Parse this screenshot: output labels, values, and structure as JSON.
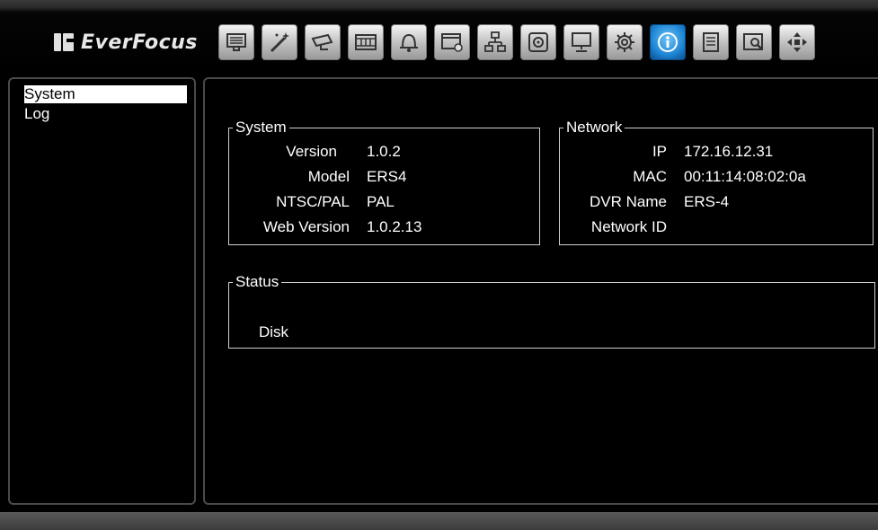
{
  "brand": {
    "logo_text": "EverFocus"
  },
  "toolbar": {
    "buttons": [
      {
        "icon": "monitor-live-icon"
      },
      {
        "icon": "wand-icon"
      },
      {
        "icon": "camera-icon"
      },
      {
        "icon": "film-icon"
      },
      {
        "icon": "bell-alarm-icon"
      },
      {
        "icon": "schedule-icon"
      },
      {
        "icon": "network-icon"
      },
      {
        "icon": "disk-icon"
      },
      {
        "icon": "display-icon"
      },
      {
        "icon": "gear-icon"
      },
      {
        "icon": "info-icon",
        "active": true
      },
      {
        "icon": "log-icon"
      },
      {
        "icon": "search-playback-icon"
      },
      {
        "icon": "move-arrows-icon"
      }
    ]
  },
  "sidebar": {
    "items": [
      {
        "label": "System",
        "selected": true
      },
      {
        "label": "Log",
        "selected": false
      }
    ]
  },
  "system": {
    "title": "System",
    "version_label": "Version",
    "version_value": "1.0.2",
    "model_label": "Model",
    "model_value": "ERS4",
    "ntsc_label": "NTSC/PAL",
    "ntsc_value": "PAL",
    "web_label": "Web Version",
    "web_value": "1.0.2.13"
  },
  "network": {
    "title": "Network",
    "ip_label": "IP",
    "ip_value": "172.16.12.31",
    "mac_label": "MAC",
    "mac_value": "00:11:14:08:02:0a",
    "dvr_label": "DVR Name",
    "dvr_value": "ERS-4",
    "netid_label": "Network ID",
    "netid_value": ""
  },
  "status": {
    "title": "Status",
    "disk_label": "Disk"
  }
}
